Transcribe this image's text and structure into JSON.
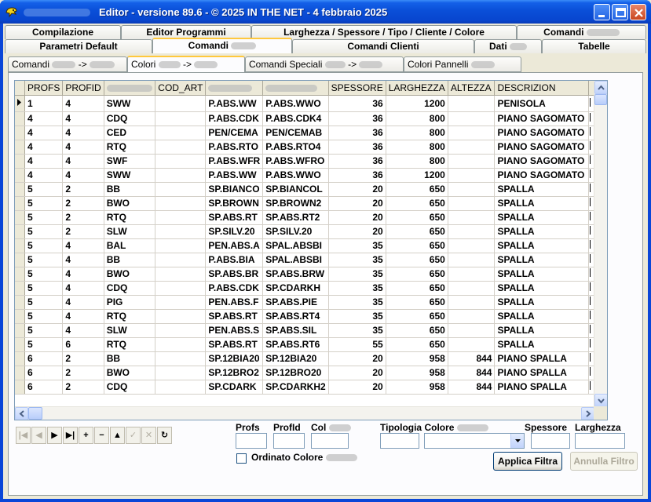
{
  "window": {
    "title": "Editor - versione 89.6 - © 2025  IN THE NET - 4 febbraio 2025"
  },
  "tabs_row1": [
    {
      "label": "Compilazione"
    },
    {
      "label": "Editor Programmi"
    },
    {
      "label": "Larghezza / Spessore / Tipo / Cliente / Colore"
    },
    {
      "label": "Comandi"
    }
  ],
  "tabs_row2": [
    {
      "label": "Parametri Default"
    },
    {
      "label": "Comandi"
    },
    {
      "label": "Comandi Clienti"
    },
    {
      "label": "Dati"
    },
    {
      "label": "Tabelle"
    }
  ],
  "subtabs": [
    {
      "label": "Comandi",
      "label2": "->"
    },
    {
      "label": "Colori",
      "label2": "->"
    },
    {
      "label": "Comandi Speciali",
      "label2": "->"
    },
    {
      "label": "Colori Pannelli"
    }
  ],
  "grid": {
    "columns": [
      "PROFS",
      "PROFID",
      "COLARTEC",
      "COD_ART",
      "ARTEC",
      "COLBALCAM",
      "SPESSORE",
      "LARGHEZZA",
      "ALTEZZA",
      "DESCRIZION"
    ],
    "rows": [
      [
        "1",
        "4",
        "SWW",
        "",
        "P.ABS.WW",
        "P.ABS.WWO",
        "36",
        "1200",
        "",
        "PENISOLA"
      ],
      [
        "4",
        "4",
        "CDQ",
        "",
        "P.ABS.CDK",
        "P.ABS.CDK4",
        "36",
        "800",
        "",
        "PIANO SAGOMATO"
      ],
      [
        "4",
        "4",
        "CED",
        "",
        "PEN/CEMA",
        "PEN/CEMAB",
        "36",
        "800",
        "",
        "PIANO SAGOMATO"
      ],
      [
        "4",
        "4",
        "RTQ",
        "",
        "P.ABS.RTO",
        "P.ABS.RTO4",
        "36",
        "800",
        "",
        "PIANO SAGOMATO"
      ],
      [
        "4",
        "4",
        "SWF",
        "",
        "P.ABS.WFR",
        "P.ABS.WFRO",
        "36",
        "800",
        "",
        "PIANO SAGOMATO"
      ],
      [
        "4",
        "4",
        "SWW",
        "",
        "P.ABS.WW",
        "P.ABS.WWO",
        "36",
        "1200",
        "",
        "PIANO SAGOMATO"
      ],
      [
        "5",
        "2",
        "BB",
        "",
        "SP.BIANCO",
        "SP.BIANCOL",
        "20",
        "650",
        "",
        "SPALLA"
      ],
      [
        "5",
        "2",
        "BWO",
        "",
        "SP.BROWN",
        "SP.BROWN2",
        "20",
        "650",
        "",
        "SPALLA"
      ],
      [
        "5",
        "2",
        "RTQ",
        "",
        "SP.ABS.RT",
        "SP.ABS.RT2",
        "20",
        "650",
        "",
        "SPALLA"
      ],
      [
        "5",
        "2",
        "SLW",
        "",
        "SP.SILV.20",
        "SP.SILV.20",
        "20",
        "650",
        "",
        "SPALLA"
      ],
      [
        "5",
        "4",
        "BAL",
        "",
        "PEN.ABS.A",
        "SPAL.ABSBI",
        "35",
        "650",
        "",
        "SPALLA"
      ],
      [
        "5",
        "4",
        "BB",
        "",
        "P.ABS.BIA",
        "SPAL.ABSBI",
        "35",
        "650",
        "",
        "SPALLA"
      ],
      [
        "5",
        "4",
        "BWO",
        "",
        "SP.ABS.BR",
        "SP.ABS.BRW",
        "35",
        "650",
        "",
        "SPALLA"
      ],
      [
        "5",
        "4",
        "CDQ",
        "",
        "P.ABS.CDK",
        "SP.CDARKH",
        "35",
        "650",
        "",
        "SPALLA"
      ],
      [
        "5",
        "4",
        "PIG",
        "",
        "PEN.ABS.F",
        "SP.ABS.PIE",
        "35",
        "650",
        "",
        "SPALLA"
      ],
      [
        "5",
        "4",
        "RTQ",
        "",
        "SP.ABS.RT",
        "SP.ABS.RT4",
        "35",
        "650",
        "",
        "SPALLA"
      ],
      [
        "5",
        "4",
        "SLW",
        "",
        "PEN.ABS.S",
        "SP.ABS.SIL",
        "35",
        "650",
        "",
        "SPALLA"
      ],
      [
        "5",
        "6",
        "RTQ",
        "",
        "SP.ABS.RT",
        "SP.ABS.RT6",
        "55",
        "650",
        "",
        "SPALLA"
      ],
      [
        "6",
        "2",
        "BB",
        "",
        "SP.12BIA20",
        "SP.12BIA20",
        "20",
        "958",
        "844",
        "PIANO SPALLA"
      ],
      [
        "6",
        "2",
        "BWO",
        "",
        "SP.12BRO2",
        "SP.12BRO20",
        "20",
        "958",
        "844",
        "PIANO SPALLA"
      ],
      [
        "6",
        "2",
        "CDQ",
        "",
        "SP.CDARK",
        "SP.CDARKH2",
        "20",
        "958",
        "844",
        "PIANO SPALLA"
      ]
    ]
  },
  "navigator": {
    "buttons": [
      {
        "glyph": "|◀",
        "icon": "first-record-icon",
        "enabled": false
      },
      {
        "glyph": "◀",
        "icon": "prior-record-icon",
        "enabled": false
      },
      {
        "glyph": "▶",
        "icon": "next-record-icon",
        "enabled": true
      },
      {
        "glyph": "▶|",
        "icon": "last-record-icon",
        "enabled": true
      },
      {
        "glyph": "+",
        "icon": "insert-record-icon",
        "enabled": true
      },
      {
        "glyph": "−",
        "icon": "delete-record-icon",
        "enabled": true
      },
      {
        "glyph": "▲",
        "icon": "edit-record-icon",
        "enabled": true
      },
      {
        "glyph": "✓",
        "icon": "post-record-icon",
        "enabled": false
      },
      {
        "glyph": "✕",
        "icon": "cancel-record-icon",
        "enabled": false
      },
      {
        "glyph": "↻",
        "icon": "refresh-record-icon",
        "enabled": true
      }
    ]
  },
  "filters": {
    "profs_label": "Profs",
    "profid_label": "ProfId",
    "col_label": "Col",
    "tipologia_label": "Tipologia Colore",
    "spessore_label": "Spessore",
    "larghezza_label": "Larghezza",
    "ordinato_label": "Ordinato Colore",
    "applica_label": "Applica Filtra",
    "annulla_label": "Annulla Filtro"
  }
}
